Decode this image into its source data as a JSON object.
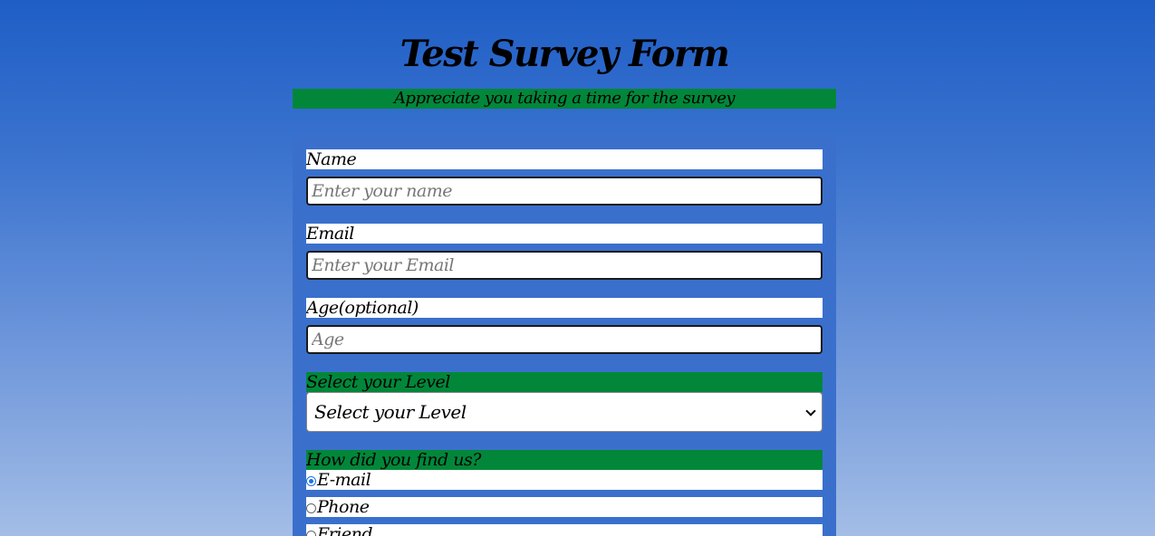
{
  "header": {
    "title": "Test Survey Form",
    "subtitle": "Appreciate you taking a time for the survey"
  },
  "form": {
    "name": {
      "label": "Name",
      "placeholder": "Enter your name",
      "value": ""
    },
    "email": {
      "label": "Email",
      "placeholder": "Enter your Email",
      "value": ""
    },
    "age": {
      "label": "Age(optional)",
      "placeholder": "Age",
      "value": ""
    },
    "level": {
      "label": "Select your Level",
      "selected": "Select your Level"
    },
    "found_us": {
      "label": "How did you find us?",
      "options": [
        {
          "label": "E-mail",
          "checked": true
        },
        {
          "label": "Phone",
          "checked": false
        },
        {
          "label": "Friend",
          "checked": false
        }
      ]
    }
  },
  "colors": {
    "accent_green": "#02873a",
    "card_blue": "#3a70cc",
    "radio_selected": "#1a73e8"
  }
}
